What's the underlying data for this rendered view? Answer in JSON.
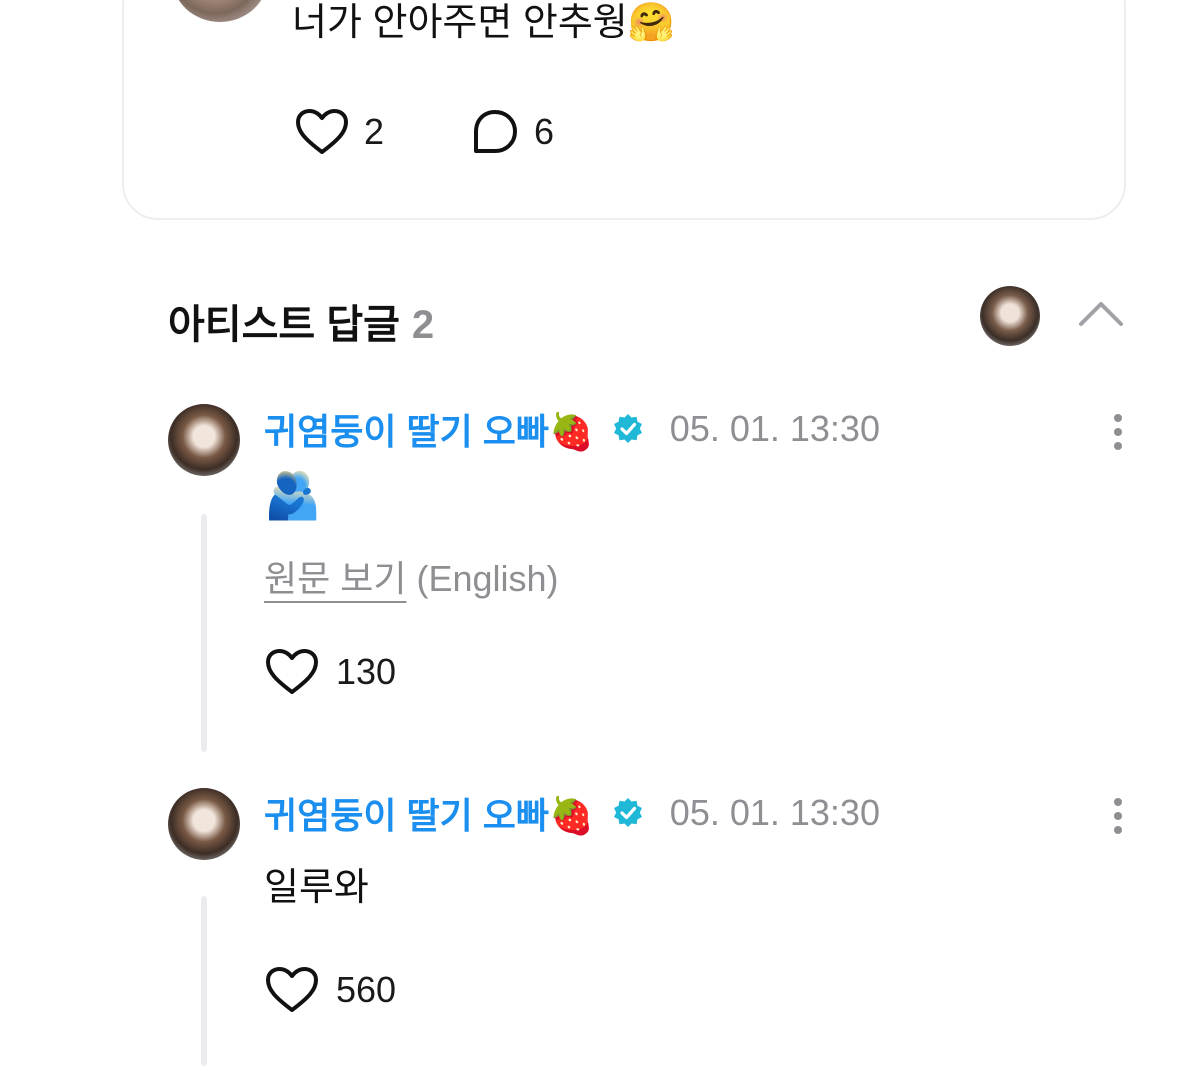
{
  "post": {
    "text": "너가 안아주면 안추웡",
    "emoji": "🤗",
    "like_count": "2",
    "comment_count": "6"
  },
  "artist_replies": {
    "title": "아티스트 답글",
    "count": "2"
  },
  "replies": [
    {
      "author": "귀염둥이 딸기 오빠🍓",
      "timestamp": "05. 01. 13:30",
      "emoji": "🫂",
      "translate_link": "원문 보기",
      "translate_lang": "(English)",
      "like_count": "130"
    },
    {
      "author": "귀염둥이 딸기 오빠🍓",
      "timestamp": "05. 01. 13:30",
      "text": "일루와",
      "like_count": "560"
    }
  ],
  "colors": {
    "accent": "#1b8fef",
    "verified": "#1fb8d6",
    "muted": "#8e8e93",
    "border": "#eceef1"
  },
  "icons": {
    "like": "heart-outline-icon",
    "comment": "speech-bubble-icon",
    "collapse": "chevron-up-icon",
    "more": "vertical-ellipsis-icon",
    "verified": "verified-badge-icon"
  }
}
